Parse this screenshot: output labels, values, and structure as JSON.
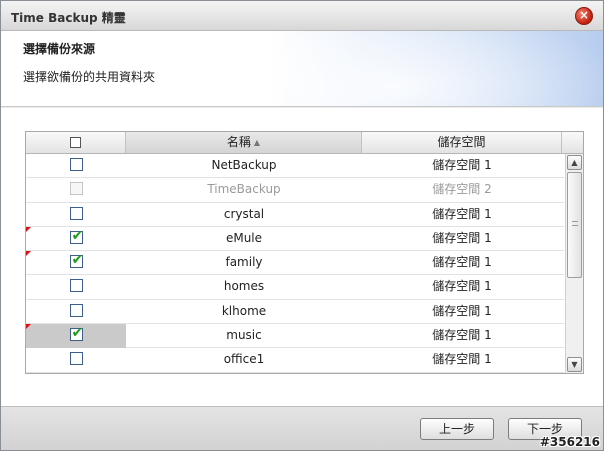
{
  "window": {
    "title": "Time Backup 精靈",
    "close_icon": "close-icon",
    "accent_close": "#c21e0c"
  },
  "header": {
    "title": "選擇備份來源",
    "description": "選擇欲備份的共用資料夾"
  },
  "table": {
    "columns": [
      "",
      "名稱",
      "儲存空間"
    ],
    "sort_indicator": "▲",
    "header_checkbox_checked": false,
    "rows": [
      {
        "name": "NetBackup",
        "storage": "儲存空間 1",
        "checked": false,
        "disabled": false,
        "flag": false,
        "selected": false
      },
      {
        "name": "TimeBackup",
        "storage": "儲存空間 2",
        "checked": false,
        "disabled": true,
        "flag": false,
        "selected": false
      },
      {
        "name": "crystal",
        "storage": "儲存空間 1",
        "checked": false,
        "disabled": false,
        "flag": false,
        "selected": false
      },
      {
        "name": "eMule",
        "storage": "儲存空間 1",
        "checked": true,
        "disabled": false,
        "flag": true,
        "selected": false
      },
      {
        "name": "family",
        "storage": "儲存空間 1",
        "checked": true,
        "disabled": false,
        "flag": true,
        "selected": false
      },
      {
        "name": "homes",
        "storage": "儲存空間 1",
        "checked": false,
        "disabled": false,
        "flag": false,
        "selected": false
      },
      {
        "name": "klhome",
        "storage": "儲存空間 1",
        "checked": false,
        "disabled": false,
        "flag": false,
        "selected": false
      },
      {
        "name": "music",
        "storage": "儲存空間 1",
        "checked": true,
        "disabled": false,
        "flag": true,
        "selected": true
      },
      {
        "name": "office1",
        "storage": "儲存空間 1",
        "checked": false,
        "disabled": false,
        "flag": false,
        "selected": false
      }
    ]
  },
  "scrollbar": {
    "up_icon": "scroll-up-icon",
    "down_icon": "scroll-down-icon"
  },
  "footer": {
    "prev_label": "上一步",
    "next_label": "下一步",
    "watermark": "#356216"
  },
  "colors": {
    "checkmark": "#1e9a1e",
    "flag": "#dd1111",
    "selected_row": "#cacaca"
  }
}
